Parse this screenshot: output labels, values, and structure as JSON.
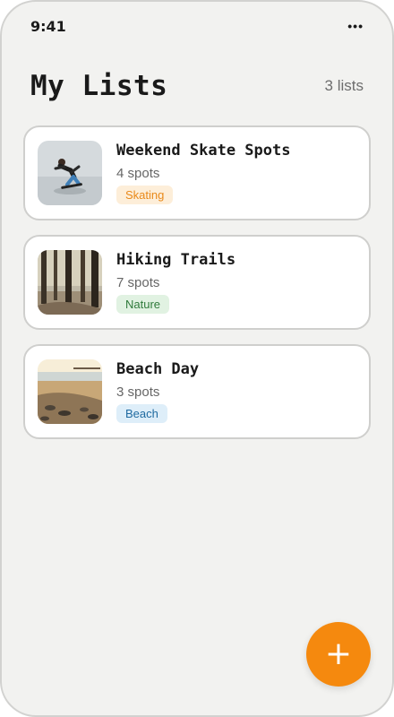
{
  "status_bar": {
    "time": "9:41",
    "menu_icon": "more-dots-icon"
  },
  "header": {
    "title": "My Lists",
    "count": "3 lists"
  },
  "lists": [
    {
      "title": "Weekend Skate Spots",
      "spots": "4 spots",
      "tag": "Skating",
      "tag_color": "#e9891a",
      "tag_bg": "#fdeed9"
    },
    {
      "title": "Hiking Trails",
      "spots": "7 spots",
      "tag": "Nature",
      "tag_color": "#2f7a3b",
      "tag_bg": "#e1f2e2"
    },
    {
      "title": "Beach Day",
      "spots": "3 spots",
      "tag": "Beach",
      "tag_color": "#1f6aa0",
      "tag_bg": "#deeef9"
    }
  ],
  "fab": {
    "icon": "plus-icon",
    "color": "#f5890e"
  }
}
